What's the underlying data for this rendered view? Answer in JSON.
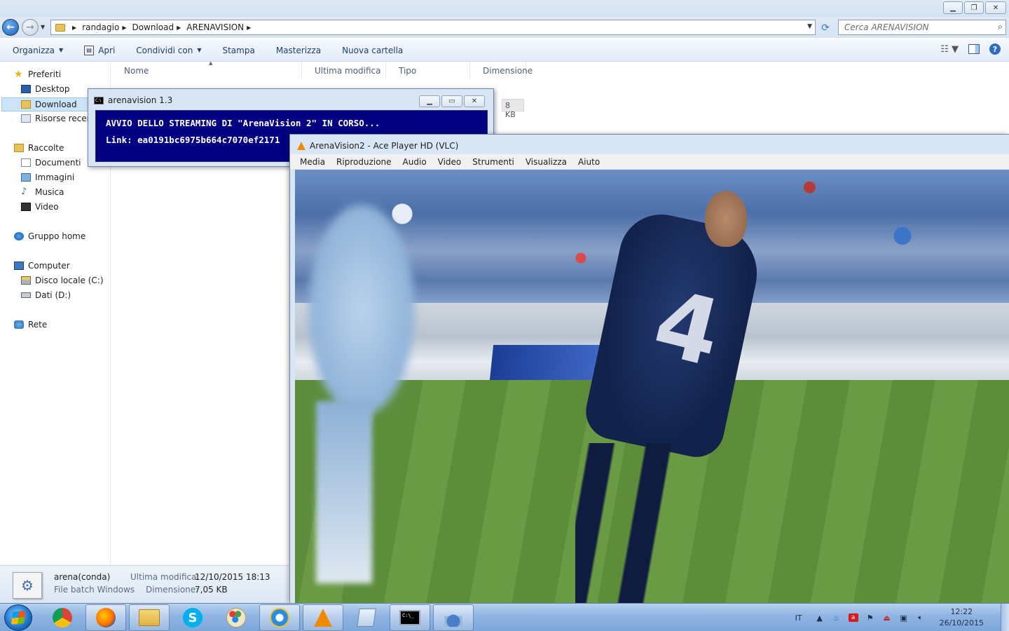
{
  "explorer": {
    "breadcrumb": [
      "randagio",
      "Download",
      "ARENAVISION"
    ],
    "search_placeholder": "Cerca ARENAVISION",
    "toolbar": {
      "organize": "Organizza",
      "open": "Apri",
      "share": "Condividi con",
      "print": "Stampa",
      "burn": "Masterizza",
      "new_folder": "Nuova cartella"
    },
    "nav": {
      "favorites": "Preferiti",
      "desktop": "Desktop",
      "download": "Download",
      "recent": "Risorse recenti",
      "libraries": "Raccolte",
      "documents": "Documenti",
      "images": "Immagini",
      "music": "Musica",
      "video": "Video",
      "homegroup": "Gruppo home",
      "computer": "Computer",
      "local_disk": "Disco locale (C:)",
      "data_disk": "Dati (D:)",
      "network": "Rete"
    },
    "columns": [
      "Nome",
      "Ultima modifica",
      "Tipo",
      "Dimensione"
    ],
    "file_size": "8 KB",
    "details": {
      "name": "arena(conda)",
      "type": "File batch Windows",
      "modified_label": "Ultima modifica:",
      "modified_value": "12/10/2015 18:13",
      "size_label": "Dimensione:",
      "size_value": "7,05 KB"
    }
  },
  "console": {
    "title": "arenavision 1.3",
    "line1": "AVVIO DELLO STREAMING DI \"ArenaVision 2\" IN CORSO...",
    "line2": "Link: ea0191bc6975b664c7070ef2171"
  },
  "vlc": {
    "title": "ArenaVision2 - Ace Player HD (VLC)",
    "menu": [
      "Media",
      "Riproduzione",
      "Audio",
      "Video",
      "Strumenti",
      "Visualizza",
      "Aiuto"
    ],
    "jersey_number": "4"
  },
  "taskbar": {
    "apps": [
      "chrome-icon",
      "firefox-icon",
      "explorer-folder-icon",
      "skype-icon",
      "paint-icon",
      "ie-icon",
      "vlc-icon",
      "notepad-icon",
      "cmd-icon",
      "aceplayer-icon"
    ],
    "language": "IT",
    "time": "12:22",
    "date": "26/10/2015"
  }
}
